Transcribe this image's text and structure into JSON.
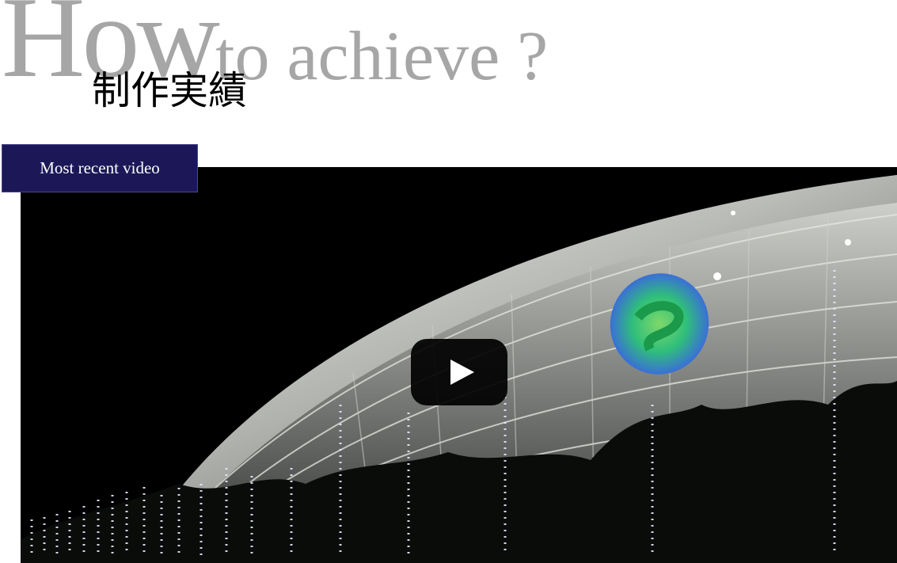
{
  "section": {
    "background_heading_big": "How",
    "background_heading_small": "to achieve ?",
    "title": "制作実績"
  },
  "video": {
    "badge_label": "Most recent video",
    "play_icon": "play-icon",
    "thumbnail_description_icon": "video-thumbnail"
  },
  "colors": {
    "background_heading": "#a6a6a6",
    "badge_background": "#1c1858",
    "play_button": "#000000"
  }
}
